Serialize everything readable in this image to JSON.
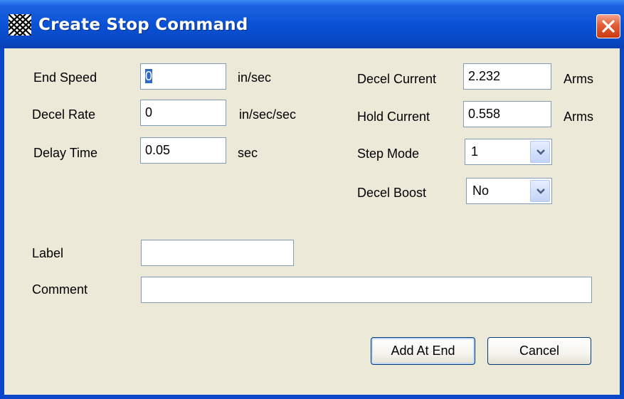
{
  "window": {
    "title": "Create Stop Command",
    "icon": "app-pattern-icon",
    "close_icon": "close-icon",
    "colors": {
      "titlebar": "#0a52d6",
      "close": "#e25d36",
      "client": "#ece9d8"
    }
  },
  "fields": {
    "end_speed": {
      "label": "End Speed",
      "value": "0",
      "unit": "in/sec"
    },
    "decel_rate": {
      "label": "Decel Rate",
      "value": "0",
      "unit": "in/sec/sec"
    },
    "delay_time": {
      "label": "Delay Time",
      "value": "0.05",
      "unit": "sec"
    },
    "decel_current": {
      "label": "Decel Current",
      "value": "2.232",
      "unit": "Arms"
    },
    "hold_current": {
      "label": "Hold Current",
      "value": "0.558",
      "unit": "Arms"
    },
    "step_mode": {
      "label": "Step Mode",
      "value": "1"
    },
    "decel_boost": {
      "label": "Decel Boost",
      "value": "No"
    },
    "label": {
      "label": "Label",
      "value": ""
    },
    "comment": {
      "label": "Comment",
      "value": ""
    }
  },
  "buttons": {
    "add_at_end": "Add At End",
    "cancel": "Cancel"
  }
}
